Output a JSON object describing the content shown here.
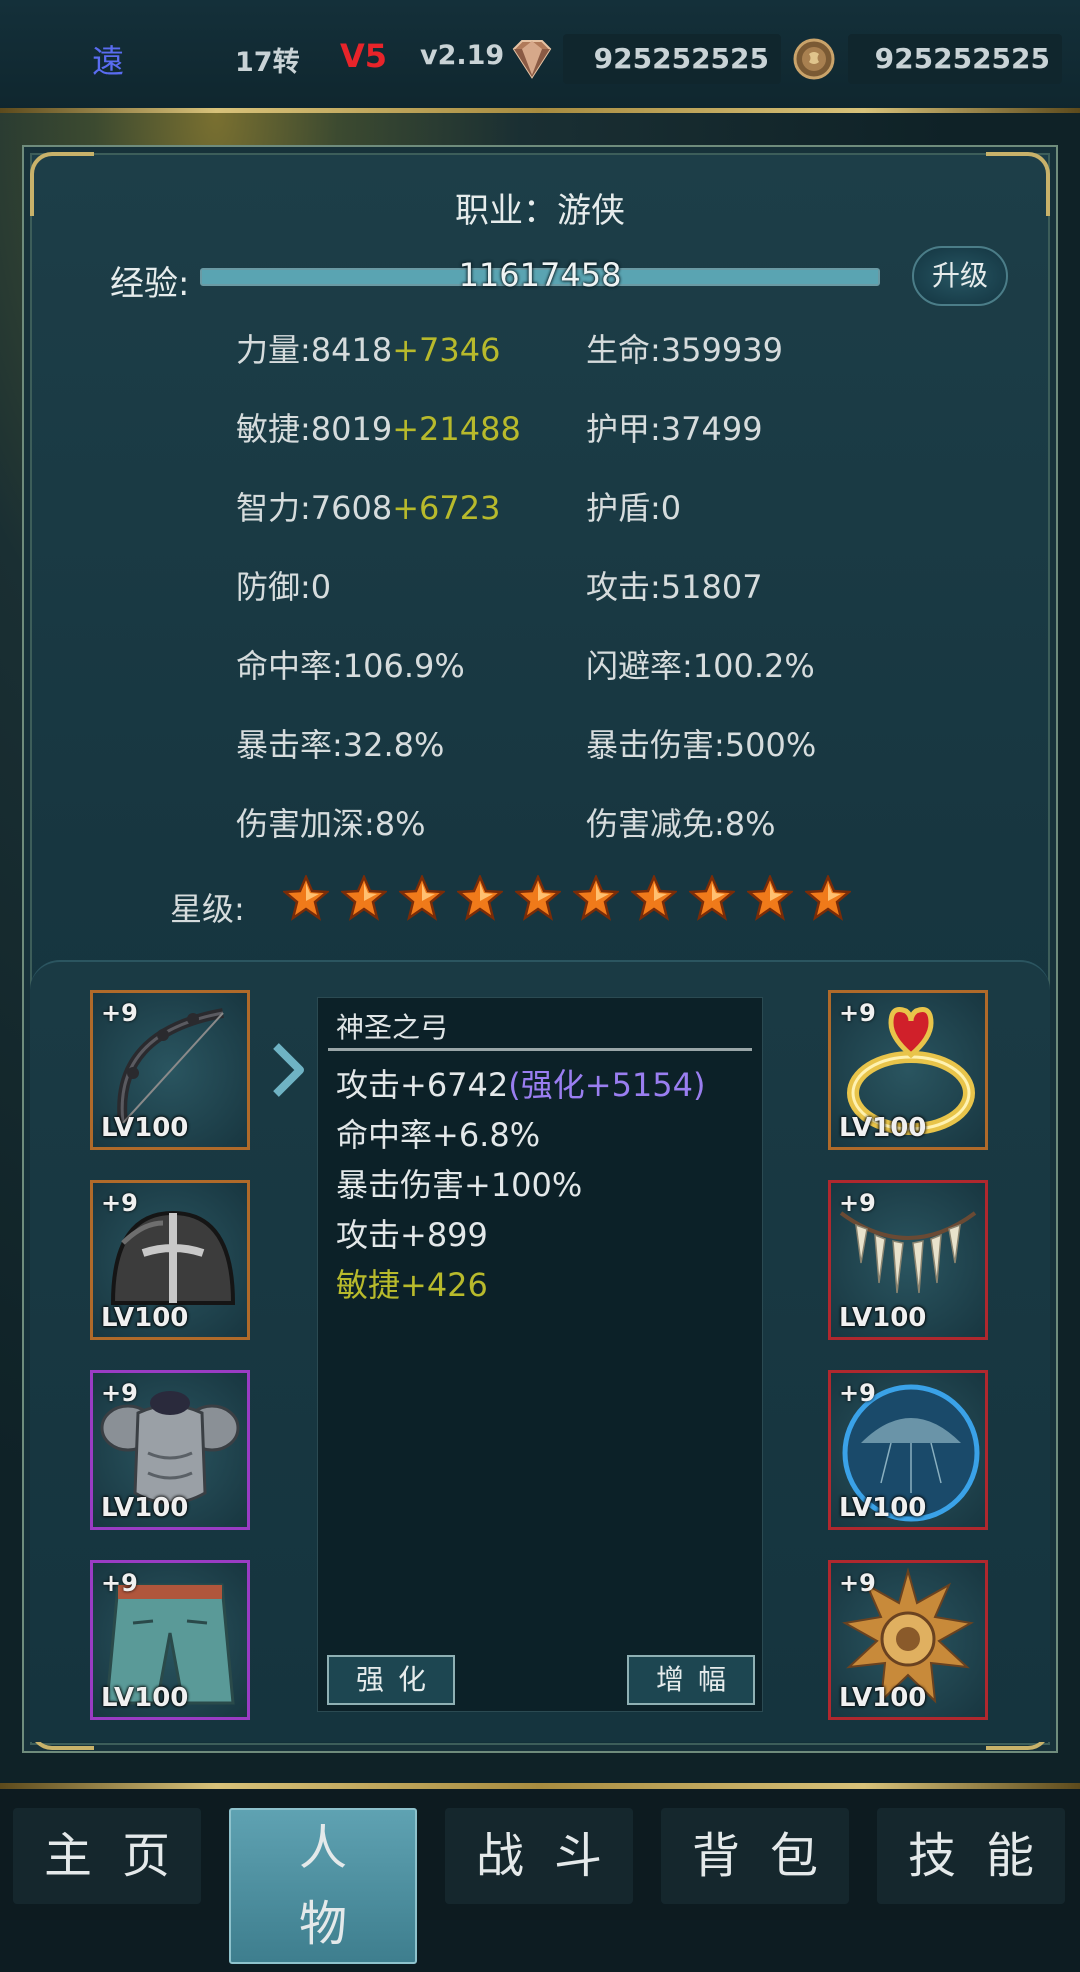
{
  "topbar": {
    "name": "遠",
    "rebirth": "17转",
    "vip": "V5",
    "version": "v2.19",
    "gems": "925252525",
    "coins": "925252525",
    "gem_icon": "diamond-icon",
    "coin_icon": "coin-icon"
  },
  "character": {
    "job": "职业：游侠",
    "exp_label": "经验:",
    "exp_value": "11617458",
    "exp_progress": 1.0,
    "upgrade_label": "升级",
    "stats": {
      "strength": {
        "base": "力量:8418",
        "bonus": "+7346"
      },
      "agility": {
        "base": "敏捷:8019",
        "bonus": "+21488"
      },
      "intelligence": {
        "base": "智力:7608",
        "bonus": "+6723"
      },
      "defense": "防御:0",
      "hit_rate": "命中率:106.9%",
      "crit_rate": "暴击率:32.8%",
      "damage_amp": "伤害加深:8%",
      "hp": "生命:359939",
      "armor": "护甲:37499",
      "shield": "护盾:0",
      "attack": "攻击:51807",
      "dodge": "闪避率:100.2%",
      "crit_damage": "暴击伤害:500%",
      "damage_reduction": "伤害减免:8%"
    },
    "star_label": "星级:",
    "stars": 10
  },
  "equipment": {
    "left": [
      {
        "plus": "+9",
        "level": "LV100",
        "icon": "bow-icon",
        "rarity": "orange"
      },
      {
        "plus": "+9",
        "level": "LV100",
        "icon": "helmet-icon",
        "rarity": "orange"
      },
      {
        "plus": "+9",
        "level": "LV100",
        "icon": "chest-armor-icon",
        "rarity": "purple"
      },
      {
        "plus": "+9",
        "level": "LV100",
        "icon": "pants-icon",
        "rarity": "purple"
      }
    ],
    "right": [
      {
        "plus": "+9",
        "level": "LV100",
        "icon": "ring-icon",
        "rarity": "orange"
      },
      {
        "plus": "+9",
        "level": "LV100",
        "icon": "necklace-icon",
        "rarity": "red"
      },
      {
        "plus": "+9",
        "level": "LV100",
        "icon": "orb-icon",
        "rarity": "red"
      },
      {
        "plus": "+9",
        "level": "LV100",
        "icon": "sun-amulet-icon",
        "rarity": "red"
      }
    ]
  },
  "detail": {
    "item_name": "神圣之弓",
    "attack": "攻击+6742",
    "attack_enhance": "(强化+5154)",
    "hit": "命中率+6.8%",
    "crit_dmg": "暴击伤害+100%",
    "attack2": "攻击+899",
    "agility": "敏捷+426",
    "enhance_btn": "强化",
    "amplify_btn": "增幅"
  },
  "nav": {
    "home": "主页",
    "character": "人物",
    "battle": "战斗",
    "bag": "背包",
    "skills": "技能"
  }
}
